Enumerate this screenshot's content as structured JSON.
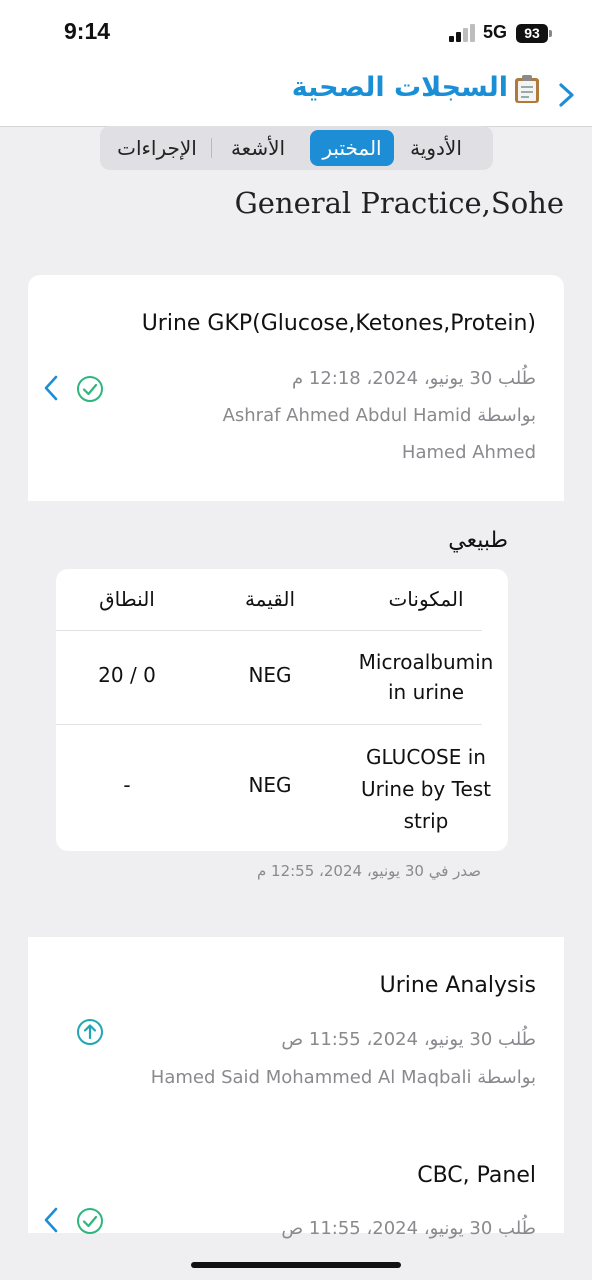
{
  "status_bar": {
    "time": "9:14",
    "network": "5G",
    "battery": "93"
  },
  "nav": {
    "title": "السجلات الصحية"
  },
  "segments": {
    "medications": "الأدوية",
    "lab": "المختبر",
    "radiology": "الأشعة",
    "procedures": "الإجراءات",
    "active": "lab"
  },
  "facility": "General Practice,Sohe",
  "orders": [
    {
      "test": "Urine GKP(Glucose,Ketones,Protein)",
      "requested": "طُلب 30 يونيو، 2024، 12:18 م",
      "by": "بواسطة Ashraf Ahmed Abdul Hamid",
      "by_continued": "Hamed Ahmed",
      "status": "completed",
      "result_status": "طبيعي",
      "table": {
        "headers": [
          "المكونات",
          "القيمة",
          "النطاق"
        ],
        "rows": [
          {
            "component": "Microalbumin in urine",
            "value": "NEG",
            "range": "20 / 0"
          },
          {
            "component": "GLUCOSE in Urine by Test strip",
            "value": "NEG",
            "range": "-"
          }
        ]
      },
      "issued": "صدر في 30 يونيو، 2024، 12:55 م"
    },
    {
      "test": "Urine Analysis",
      "requested": "طُلب 30 يونيو، 2024، 11:55 ص",
      "by": "بواسطة Hamed Said Mohammed Al Maqbali",
      "status": "pending"
    },
    {
      "test": "CBC, Panel",
      "requested": "طُلب 30 يونيو، 2024، 11:55 ص",
      "status": "completed"
    }
  ],
  "colors": {
    "accent": "#1d8ed6",
    "success": "#2fb67c",
    "pending": "#22a6b3"
  }
}
